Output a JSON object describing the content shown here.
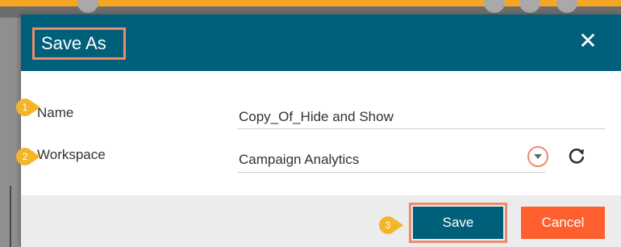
{
  "dialog": {
    "title": "Save As",
    "close_label": "✕"
  },
  "form": {
    "name_label": "Name",
    "name_value": "Copy_Of_Hide and Show",
    "workspace_label": "Workspace",
    "workspace_value": "Campaign Analytics"
  },
  "buttons": {
    "save_label": "Save",
    "cancel_label": "Cancel"
  },
  "callouts": [
    "1",
    "2",
    "3"
  ],
  "icons": {
    "close": "close-icon",
    "dropdown": "chevron-down-icon",
    "refresh": "refresh-icon"
  },
  "colors": {
    "header": "#00607a",
    "save_button": "#00607a",
    "cancel_button": "#ff5f2e",
    "highlight": "#ee8a6a",
    "callout": "#f5b52a"
  }
}
